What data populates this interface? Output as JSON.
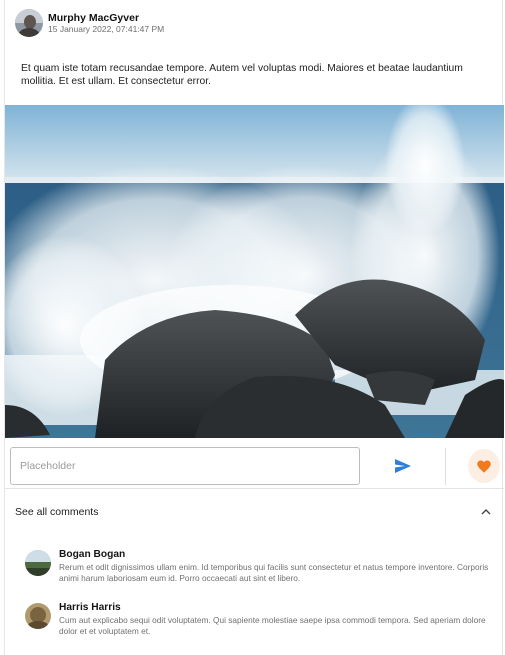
{
  "post": {
    "author": "Murphy MacGyver",
    "date": "15 January 2022, 07:41:47 PM",
    "body": "Et quam iste totam recusandae tempore. Autem vel voluptas modi. Maiores et beatae laudantium mollitia. Et est ullam. Et consectetur error."
  },
  "composer": {
    "placeholder": "Placeholder",
    "send_icon": "send-icon",
    "like_icon": "heart-icon"
  },
  "comments_section": {
    "toggle_label": "See all comments",
    "toggle_icon": "chevron-up-icon",
    "items": [
      {
        "author": "Bogan Bogan",
        "text": "Rerum et odit dignissimos ullam enim. Id temporibus qui facilis sunt consectetur et natus tempore inventore. Corporis animi harum laboriosam eum id. Porro occaecati aut sint et libero."
      },
      {
        "author": "Harris Harris",
        "text": "Cum aut explicabo sequi odit voluptatem. Qui sapiente molestiae saepe ipsa commodi tempora. Sed aperiam dolore dolor et et voluptatem et."
      }
    ]
  },
  "colors": {
    "accent": "#2f7fd8",
    "like": "#f07a1e",
    "like_bg": "#fdeee4"
  }
}
